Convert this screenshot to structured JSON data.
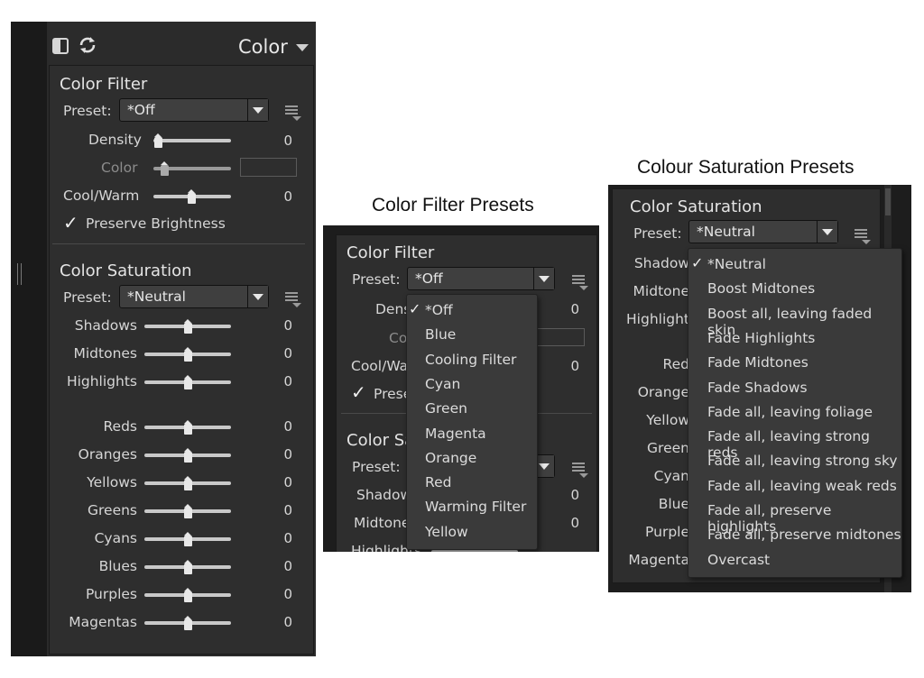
{
  "left": {
    "header_title": "Color",
    "color_filter": {
      "title": "Color Filter",
      "preset_label": "Preset:",
      "preset_value": "*Off",
      "density": {
        "label": "Density",
        "value": "0"
      },
      "color": {
        "label": "Color"
      },
      "coolwarm": {
        "label": "Cool/Warm",
        "value": "0"
      },
      "preserve": {
        "checkmark": "✓",
        "label": "Preserve Brightness"
      }
    },
    "color_saturation": {
      "title": "Color Saturation",
      "preset_label": "Preset:",
      "preset_value": "*Neutral",
      "rows": [
        {
          "label": "Shadows",
          "value": "0"
        },
        {
          "label": "Midtones",
          "value": "0"
        },
        {
          "label": "Highlights",
          "value": "0"
        },
        {
          "label": "Reds",
          "value": "0"
        },
        {
          "label": "Oranges",
          "value": "0"
        },
        {
          "label": "Yellows",
          "value": "0"
        },
        {
          "label": "Greens",
          "value": "0"
        },
        {
          "label": "Cyans",
          "value": "0"
        },
        {
          "label": "Blues",
          "value": "0"
        },
        {
          "label": "Purples",
          "value": "0"
        },
        {
          "label": "Magentas",
          "value": "0"
        }
      ]
    }
  },
  "middle": {
    "caption": "Color Filter Presets",
    "section_title": "Color Filter",
    "preset_label": "Preset:",
    "preset_value": "*Off",
    "density_label_partial": "Dens",
    "color_label_partial": "Co",
    "coolwarm_label_partial": "Cool/Wa",
    "preserve_label_partial": "Prese",
    "checkmark": "✓",
    "sat_title_partial": "Color Sa",
    "sat_preset_label": "Preset:",
    "shadows_partial": "Shadow",
    "midtones_partial": "Midtone",
    "highlights_partial": "Highlights",
    "values": [
      "0",
      "0",
      "0",
      "0"
    ],
    "menu_check": "✓",
    "menu_items": [
      "*Off",
      "Blue",
      "Cooling Filter",
      "Cyan",
      "Green",
      "Magenta",
      "Orange",
      "Red",
      "Warming Filter",
      "Yellow"
    ]
  },
  "right": {
    "caption": "Colour Saturation Presets",
    "section_title": "Color Saturation",
    "preset_label": "Preset:",
    "preset_value": "*Neutral",
    "row_labels_partial": [
      "Shadow",
      "Midtone",
      "Highlight",
      "Red",
      "Orange",
      "Yellow",
      "Green",
      "Cyan",
      "Blue",
      "Purple",
      "Magenta"
    ],
    "menu_check": "✓",
    "menu_items": [
      "*Neutral",
      "Boost Midtones",
      "Boost all, leaving faded skin",
      "Fade Highlights",
      "Fade Midtones",
      "Fade Shadows",
      "Fade all, leaving foliage",
      "Fade all, leaving strong reds",
      "Fade all, leaving strong sky",
      "Fade all, leaving weak reds",
      "Fade all, preserve highlights",
      "Fade all, preserve midtones",
      "Overcast"
    ]
  },
  "icons": {
    "panel_toggle": "panel-toggle-icon",
    "reset": "reset-icon",
    "collapse": "collapse-triangle-icon",
    "options_menu": "options-menu-icon",
    "dropdown_arrow": "chevron-down-icon"
  }
}
